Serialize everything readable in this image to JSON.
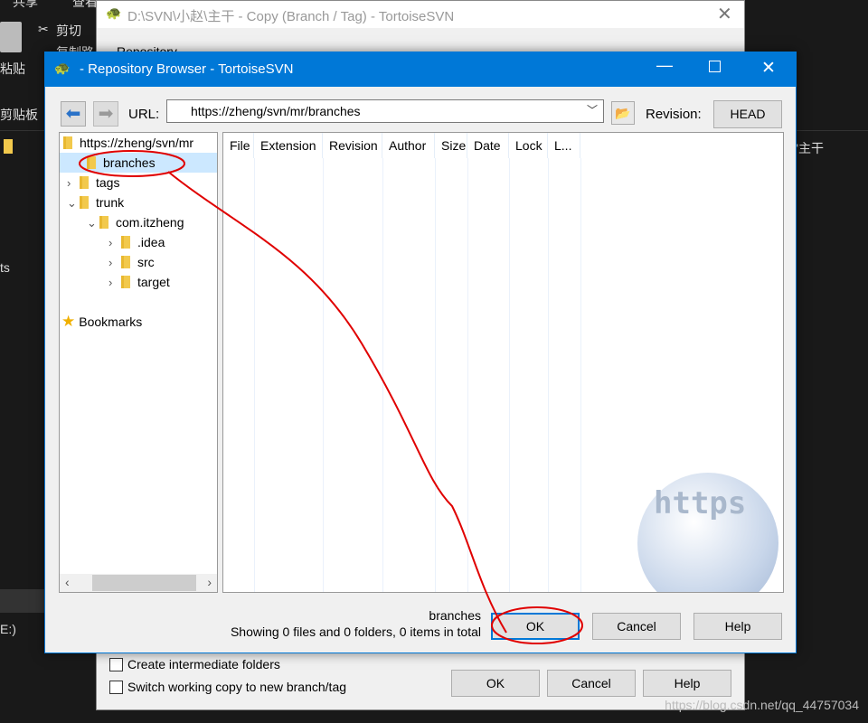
{
  "explorer": {
    "ribbon_top": [
      "共享",
      "查看"
    ],
    "cut": "剪切",
    "copy_path": "复制路",
    "paste": "粘贴",
    "clipboard": "剪贴板",
    "left_text1": "ts",
    "left_text2": "E:)",
    "right_text": "\"主干"
  },
  "copy_dialog": {
    "title": "D:\\SVN\\小赵\\主干 - Copy (Branch / Tag) - TortoiseSVN",
    "repository_label": "Repository",
    "create_intermediate": "Create intermediate folders",
    "switch_wc": "Switch working copy to new branch/tag",
    "ok": "OK",
    "cancel": "Cancel",
    "help": "Help"
  },
  "repo_browser": {
    "title": "- Repository Browser - TortoiseSVN",
    "url_label": "URL:",
    "url": "https://zheng/svn/mr/branches",
    "revision_label": "Revision:",
    "revision": "HEAD",
    "tree": [
      {
        "label": "https://zheng/svn/mr",
        "level": 0,
        "expander": ""
      },
      {
        "label": "branches",
        "level": 1,
        "expander": "",
        "selected": true
      },
      {
        "label": "tags",
        "level": 1,
        "expander": ">"
      },
      {
        "label": "trunk",
        "level": 1,
        "expander": "v"
      },
      {
        "label": "com.itzheng",
        "level": 2,
        "expander": "v"
      },
      {
        "label": ".idea",
        "level": 3,
        "expander": ">"
      },
      {
        "label": "src",
        "level": 3,
        "expander": ">"
      },
      {
        "label": "target",
        "level": 3,
        "expander": ">"
      }
    ],
    "bookmarks": "Bookmarks",
    "columns": [
      "File",
      "Extension",
      "Revision",
      "Author",
      "Size",
      "Date",
      "Lock",
      "L..."
    ],
    "status_path": "branches",
    "status_summary": "Showing 0 files and 0 folders, 0 items in total",
    "ok": "OK",
    "cancel": "Cancel",
    "help": "Help",
    "watermark": "https"
  },
  "page_watermark": "https://blog.csdn.net/qq_44757034",
  "colors": {
    "accent": "#0078d7",
    "selection": "#cce8ff",
    "annotation": "#e00000"
  }
}
